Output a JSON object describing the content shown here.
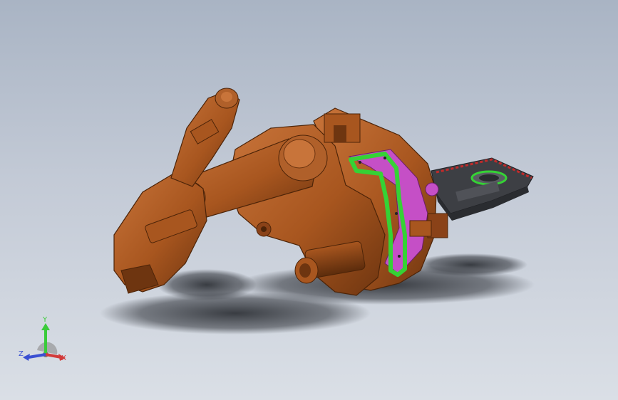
{
  "app": {
    "mode": "3d-model-viewport"
  },
  "model": {
    "colors": {
      "robot_body": "#a8561f",
      "robot_dark": "#6e3510",
      "robot_light": "#c8743a",
      "gasket_green": "#35d235",
      "housing_magenta": "#c54fc6",
      "base_dark": "#3d3f44",
      "base_accent_red": "#c22a2a",
      "shadow": "#2a2d33"
    }
  },
  "triad": {
    "x_label": "X",
    "y_label": "Y",
    "z_label": "Z",
    "colors": {
      "x": "#d23a3a",
      "y": "#3acb3a",
      "z": "#3a4fd2"
    }
  }
}
